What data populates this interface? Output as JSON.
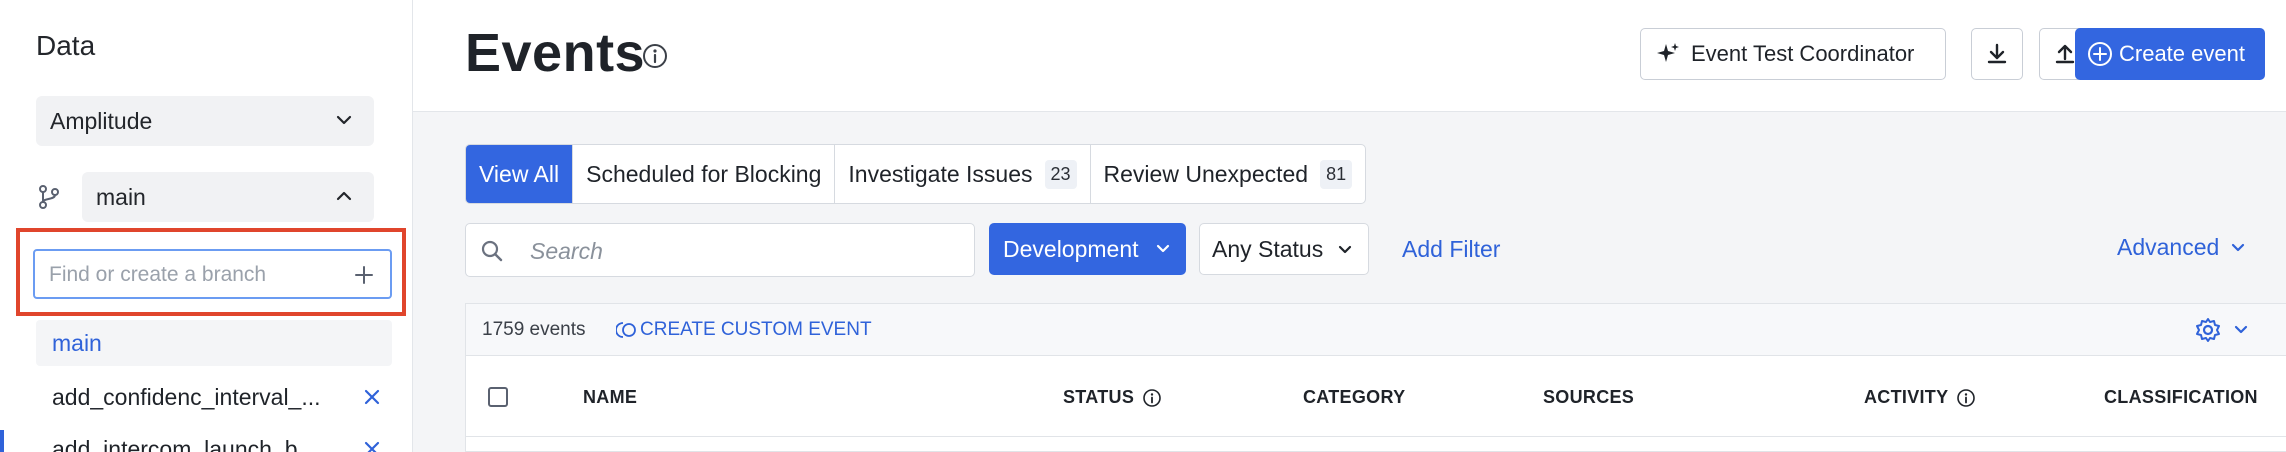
{
  "sidebar": {
    "title": "Data",
    "source_select": "Amplitude",
    "branch_select": "main",
    "branch_input_placeholder": "Find or create a branch",
    "branches": [
      {
        "label": "main"
      },
      {
        "label": "add_confidenc_interval_..."
      },
      {
        "label": "add_intercom_launch_b..."
      }
    ]
  },
  "header": {
    "title": "Events",
    "coordinator_label": "Event Test Coordinator",
    "create_label": "Create event"
  },
  "tabs": [
    {
      "label": "View All",
      "count": null
    },
    {
      "label": "Scheduled for Blocking",
      "count": null
    },
    {
      "label": "Investigate Issues",
      "count": "23"
    },
    {
      "label": "Review Unexpected",
      "count": "81"
    }
  ],
  "filters": {
    "search_placeholder": "Search",
    "environment": "Development",
    "status": "Any Status",
    "add_filter": "Add Filter",
    "advanced": "Advanced"
  },
  "table": {
    "event_count": "1759 events",
    "create_custom_event": "CREATE CUSTOM EVENT",
    "columns": {
      "name": "NAME",
      "status": "STATUS",
      "category": "CATEGORY",
      "sources": "SOURCES",
      "activity": "ACTIVITY",
      "classification": "CLASSIFICATION"
    }
  },
  "colors": {
    "accent": "#3366e0",
    "highlight": "#e0452c"
  }
}
